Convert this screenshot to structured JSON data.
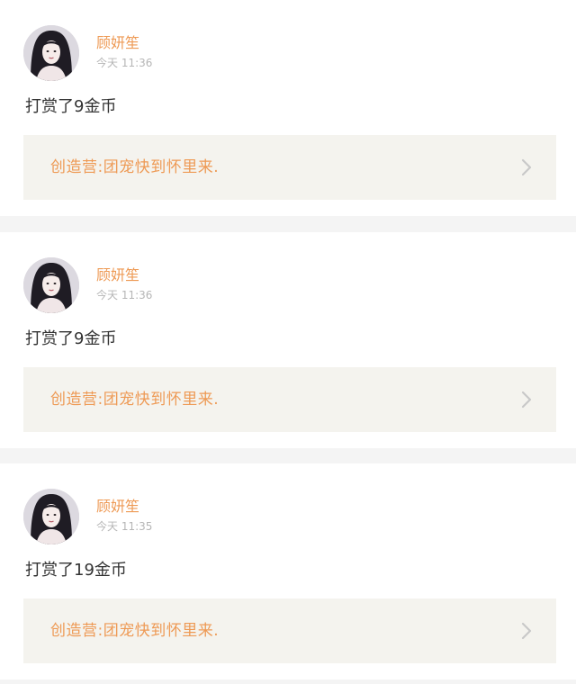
{
  "feed": {
    "items": [
      {
        "user": {
          "name": "顾妍笙",
          "avatar_icon": "profile-photo"
        },
        "timestamp": "今天 11:36",
        "message": "打赏了9金币",
        "link": {
          "title": "创造营:团宠快到怀里来.",
          "icon": "chevron-right-icon"
        }
      },
      {
        "user": {
          "name": "顾妍笙",
          "avatar_icon": "profile-photo"
        },
        "timestamp": "今天 11:36",
        "message": "打赏了9金币",
        "link": {
          "title": "创造营:团宠快到怀里来.",
          "icon": "chevron-right-icon"
        }
      },
      {
        "user": {
          "name": "顾妍笙",
          "avatar_icon": "profile-photo"
        },
        "timestamp": "今天 11:35",
        "message": "打赏了19金币",
        "link": {
          "title": "创造营:团宠快到怀里来.",
          "icon": "chevron-right-icon"
        }
      }
    ]
  },
  "colors": {
    "accent": "#ee9a55",
    "background": "#f4f4f4",
    "card": "#ffffff",
    "link_box": "#f4f3ee",
    "text": "#333333",
    "muted": "#b6b6b6"
  }
}
